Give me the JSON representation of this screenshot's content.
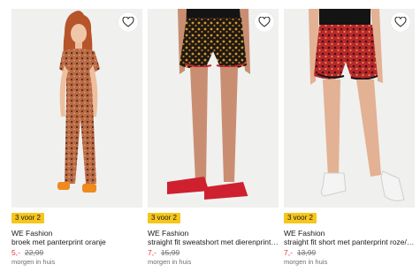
{
  "colors": {
    "badge": "#f6c61b",
    "sale_price": "#e2343b"
  },
  "products": [
    {
      "badge": "3 voor 2",
      "brand": "WE Fashion",
      "title": "broek met panterprint oranje",
      "price_new": "5,-",
      "price_old": "22,99",
      "delivery": "morgen in huis",
      "fav_icon": "heart-icon"
    },
    {
      "badge": "3 voor 2",
      "brand": "WE Fashion",
      "title": "straight fit sweatshort met dierenprint e...",
      "price_new": "7,-",
      "price_old": "15,99",
      "delivery": "morgen in huis",
      "fav_icon": "heart-icon"
    },
    {
      "badge": "3 voor 2",
      "brand": "WE Fashion",
      "title": "straight fit short met panterprint roze/z...",
      "price_new": "7,-",
      "price_old": "13,99",
      "delivery": "morgen in huis",
      "fav_icon": "heart-icon"
    }
  ]
}
